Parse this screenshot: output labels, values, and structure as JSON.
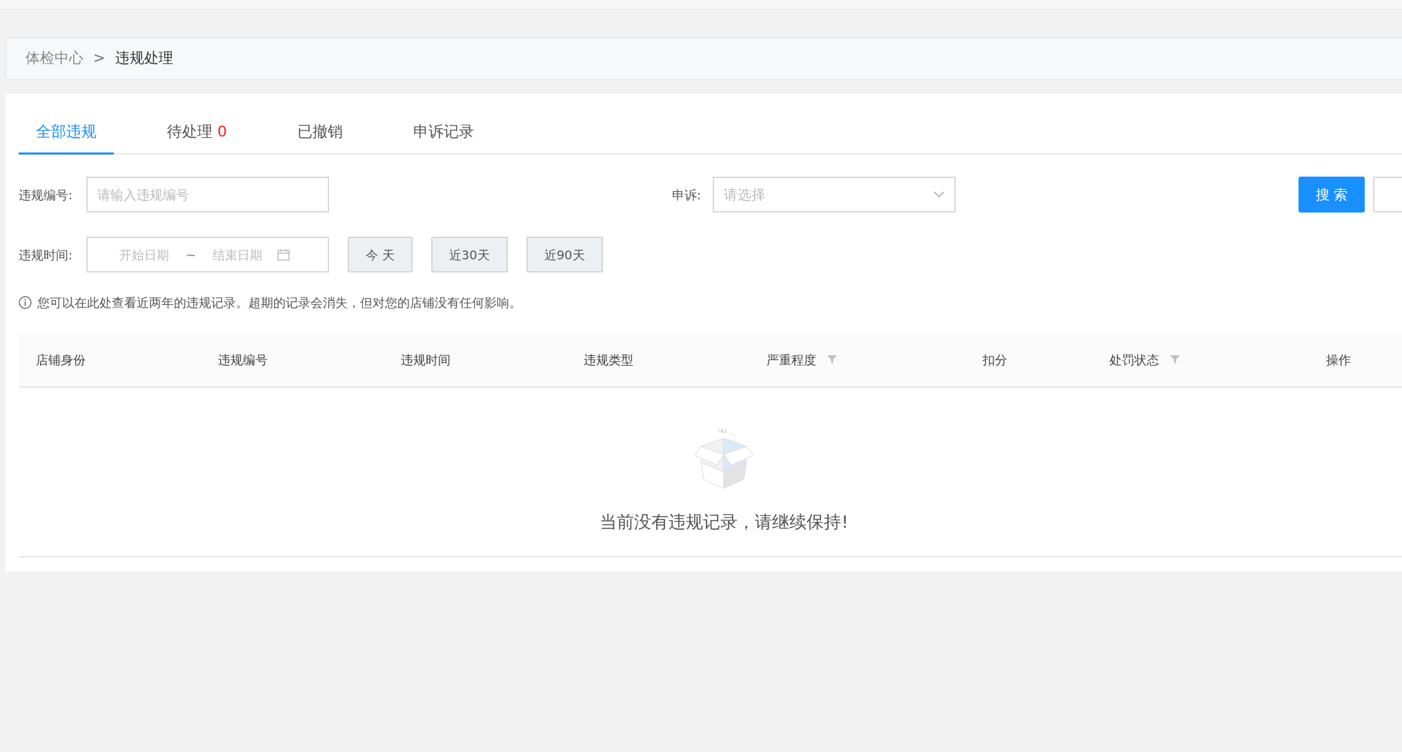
{
  "breadcrumb": {
    "separator": ">",
    "items": [
      {
        "label": "体检中心",
        "current": false
      },
      {
        "label": "违规处理",
        "current": true
      }
    ]
  },
  "tabs": [
    {
      "label": "全部违规",
      "selected": true
    },
    {
      "label": "待处理",
      "count": "0",
      "selected": false
    },
    {
      "label": "已撤销",
      "selected": false
    },
    {
      "label": "申诉记录",
      "selected": false
    }
  ],
  "filters": {
    "violation_no": {
      "label": "违规编号:",
      "placeholder": "请输入违规编号"
    },
    "appeal": {
      "label": "申诉:",
      "placeholder": "请选择"
    },
    "search_button": "搜 索",
    "time": {
      "label": "违规时间:",
      "start_placeholder": "开始日期",
      "separator": "~",
      "end_placeholder": "结束日期"
    },
    "quick_ranges": [
      "今 天",
      "近30天",
      "近90天"
    ]
  },
  "notice": "您可以在此处查看近两年的违规记录。超期的记录会消失，但对您的店铺没有任何影响。",
  "table": {
    "columns": [
      {
        "label": "店铺身份"
      },
      {
        "label": "违规编号"
      },
      {
        "label": "违规时间"
      },
      {
        "label": "违规类型"
      },
      {
        "label": "严重程度",
        "filter": true
      },
      {
        "label": "扣分"
      },
      {
        "label": "处罚状态",
        "filter": true
      },
      {
        "label": "操作"
      }
    ],
    "empty_message": "当前没有违规记录，请继续保持!"
  }
}
